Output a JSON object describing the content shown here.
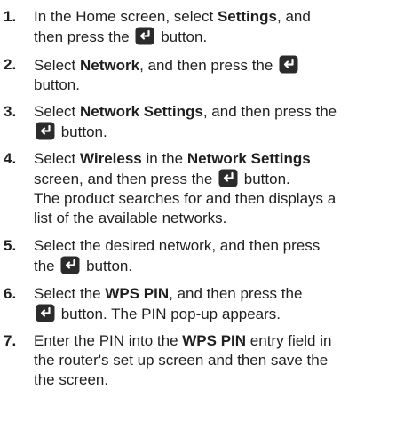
{
  "steps": [
    {
      "number": "1.",
      "parts": {
        "a": "In the Home screen, select ",
        "b": "Settings",
        "c": ", and",
        "d": "then press the ",
        "e": " button."
      }
    },
    {
      "number": "2.",
      "parts": {
        "a": "Select ",
        "b": "Network",
        "c": ", and then press the ",
        "d": "button."
      }
    },
    {
      "number": "3.",
      "parts": {
        "a": "Select ",
        "b": "Network Settings",
        "c": ", and then press the",
        "d": " button."
      }
    },
    {
      "number": "4.",
      "parts": {
        "a": "Select ",
        "b": "Wireless",
        "c": " in the ",
        "d": "Network Settings",
        "e": "screen, and then press the ",
        "f": " button.",
        "g": "The product searches for and then displays a",
        "h": "list of the available networks."
      }
    },
    {
      "number": "5.",
      "parts": {
        "a": "Select the desired network, and then press",
        "b": "the ",
        "c": " button."
      }
    },
    {
      "number": "6.",
      "parts": {
        "a": "Select the ",
        "b": "WPS PIN",
        "c": ", and then press the",
        "d": " button. The PIN pop-up appears."
      }
    },
    {
      "number": "7.",
      "parts": {
        "a": "Enter the PIN into the ",
        "b": "WPS PIN",
        "c": " entry field in",
        "d": "the router's set up screen and then save the",
        "e": "the screen."
      }
    }
  ],
  "icon": {
    "name": "enter-button-icon",
    "color": "#2b2b2b"
  }
}
